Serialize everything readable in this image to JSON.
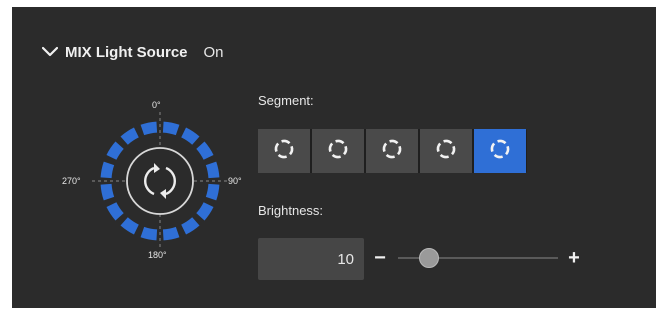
{
  "section": {
    "title": "MIX Light Source",
    "state": "On"
  },
  "dial": {
    "top_label": "0°",
    "right_label": "90°",
    "bottom_label": "180°",
    "left_label": "270°",
    "ring_color": "#2f6fd6"
  },
  "segment": {
    "label": "Segment:",
    "options": [
      "ring-icon",
      "ring-icon",
      "ring-icon",
      "ring-icon",
      "ring-icon"
    ],
    "selected_index": 4
  },
  "brightness": {
    "label": "Brightness:",
    "value": "10",
    "minus_label": "−",
    "plus_label": "+",
    "level": 0.15
  }
}
